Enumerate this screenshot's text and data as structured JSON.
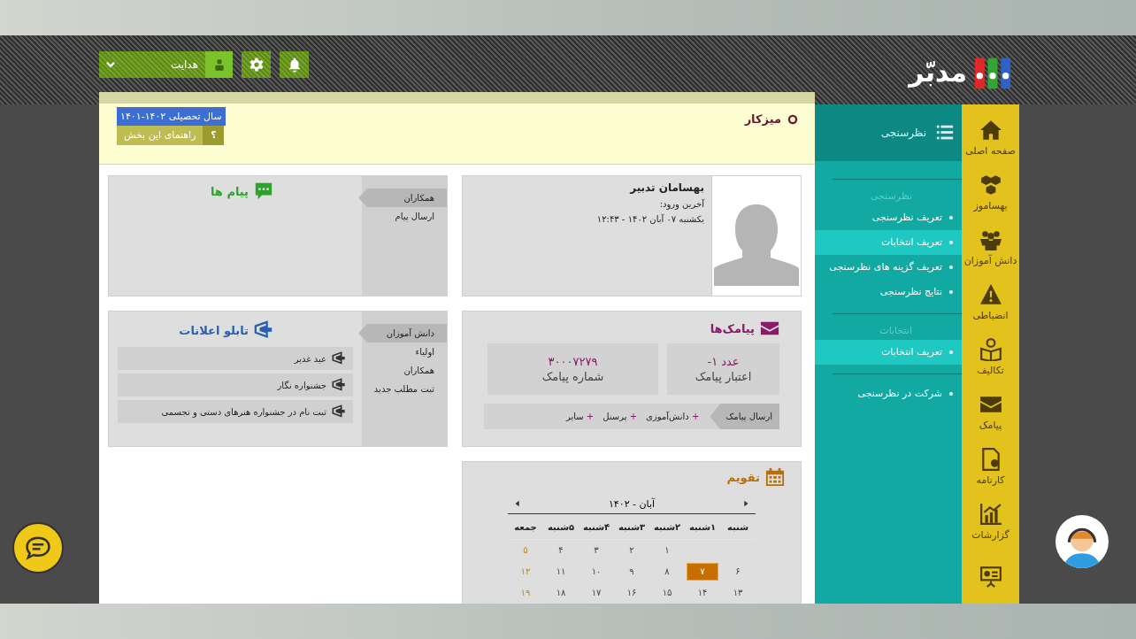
{
  "header": {
    "logo_text": "مدبّر",
    "notifications": {
      "kind": "bell"
    },
    "settings": {
      "kind": "gear"
    },
    "user": {
      "name": "هدایت"
    }
  },
  "rail": [
    {
      "kind": "home",
      "label": "صفحه اصلی"
    },
    {
      "kind": "cubes",
      "label": "بهساموز"
    },
    {
      "kind": "people",
      "label": "دانش آموزان"
    },
    {
      "kind": "warning",
      "label": "انضباطی"
    },
    {
      "kind": "reader",
      "label": "تکالیف"
    },
    {
      "kind": "envelope",
      "label": "پیامک"
    },
    {
      "kind": "certificate",
      "label": "کارنامه"
    },
    {
      "kind": "chart",
      "label": "گزارشات"
    },
    {
      "kind": "presentation"
    }
  ],
  "sidebar": {
    "title": "نظرسنجی",
    "sections": [
      {
        "heading": "نظرسنجی",
        "items": [
          {
            "label": "تعریف نظرسنجی",
            "selected": false
          },
          {
            "label": "تعریف انتخابات",
            "selected": true
          },
          {
            "label": "تعریف گزینه های نظرسنجی",
            "selected": false
          },
          {
            "label": "نتایج نظرسنجی",
            "selected": false
          }
        ]
      },
      {
        "heading": "انتخابات",
        "items": [
          {
            "label": "تعریف انتخابات",
            "selected": true
          }
        ]
      },
      {
        "items": [
          {
            "label": "شرکت در نظرسنجی",
            "selected": false
          }
        ]
      }
    ]
  },
  "page": {
    "title": "میزکار",
    "year_badge": "سال تحصیلی ۱۴۰۲-۱۴۰۱",
    "help": {
      "icon_text": "؟",
      "label": "راهنمای این بخش"
    }
  },
  "profile": {
    "name": "بهسامان تدبیر",
    "last_login_label": "آخرین ورود:",
    "last_login": "یکشنبه ۰۷ آبان ۱۴۰۲ - ۱۲:۴۳"
  },
  "messages": {
    "title": "پیام ها",
    "tabs": [
      {
        "label": "همکاران",
        "selected": true
      },
      {
        "label": "ارسال پیام",
        "selected": false
      }
    ]
  },
  "sms": {
    "title": "پیامک‌ها",
    "stats": [
      {
        "value": "-۱",
        "unit": "عدد",
        "label": "اعتبار پیامک"
      },
      {
        "value": "۳۰۰۰۷۲۷۹",
        "label": "شماره پیامک"
      }
    ],
    "send_label": "ارسال پیامک",
    "recipients": [
      {
        "plus": "+",
        "label": "دانش‌آموزی"
      },
      {
        "plus": "+",
        "label": "پرسنل"
      },
      {
        "plus": "+",
        "label": "سایر"
      }
    ]
  },
  "notices": {
    "title": "تابلو اعلانات",
    "tabs": [
      {
        "label": "دانش آموزان",
        "selected": true
      },
      {
        "label": "اولیاء",
        "selected": false
      },
      {
        "label": "همکاران",
        "selected": false
      },
      {
        "label": "ثبت مطلب جدید",
        "selected": false
      }
    ],
    "items": [
      "عید غدیر",
      "جشنواره نگار",
      "ثبت نام در جشنواره هنرهای دستی و تجسمی"
    ]
  },
  "calendar": {
    "title": "تقویم",
    "month": "آبان - ۱۴۰۲",
    "weekdays": [
      "شنبه",
      "۱شنبه",
      "۲شنبه",
      "۳شنبه",
      "۴شنبه",
      "۵شنبه",
      "جمعه"
    ],
    "weeks": [
      [
        {
          "kind": "blank"
        },
        {
          "kind": "blank"
        },
        {
          "day": "۱",
          "selected": false,
          "holiday": false
        },
        {
          "day": "۲",
          "selected": false,
          "holiday": false
        },
        {
          "day": "۳",
          "selected": false,
          "holiday": false
        },
        {
          "day": "۴",
          "selected": false,
          "holiday": false
        },
        {
          "day": "۵",
          "selected": false,
          "holiday": true
        }
      ],
      [
        {
          "day": "۶",
          "selected": false,
          "holiday": false
        },
        {
          "day": "۷",
          "selected": true,
          "holiday": false
        },
        {
          "day": "۸",
          "selected": false,
          "holiday": false
        },
        {
          "day": "۹",
          "selected": false,
          "holiday": false
        },
        {
          "day": "۱۰",
          "selected": false,
          "holiday": false
        },
        {
          "day": "۱۱",
          "selected": false,
          "holiday": false
        },
        {
          "day": "۱۲",
          "selected": false,
          "holiday": true
        }
      ],
      [
        {
          "day": "۱۳",
          "selected": false,
          "holiday": false
        },
        {
          "day": "۱۴",
          "selected": false,
          "holiday": false
        },
        {
          "day": "۱۵",
          "selected": false,
          "holiday": false
        },
        {
          "day": "۱۶",
          "selected": false,
          "holiday": false
        },
        {
          "day": "۱۷",
          "selected": false,
          "holiday": false
        },
        {
          "day": "۱۸",
          "selected": false,
          "holiday": false
        },
        {
          "day": "۱۹",
          "selected": false,
          "holiday": true
        }
      ]
    ]
  }
}
